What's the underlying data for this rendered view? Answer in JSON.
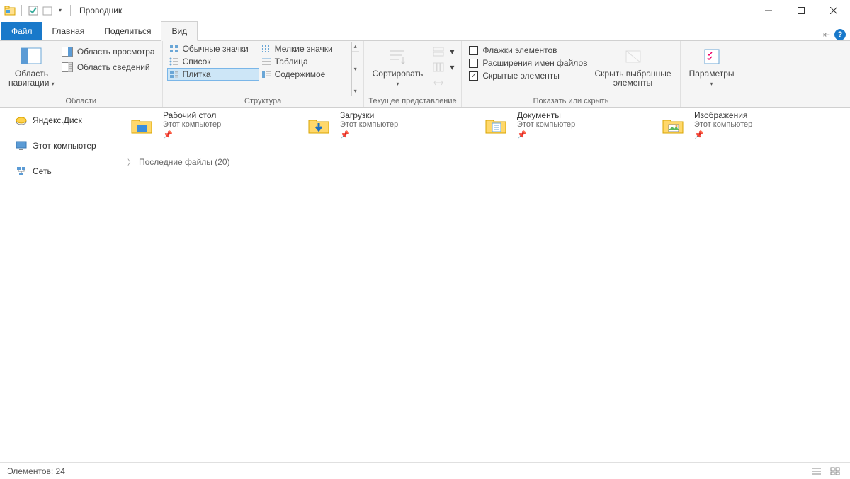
{
  "window": {
    "title": "Проводник"
  },
  "tabs": {
    "file": "Файл",
    "home": "Главная",
    "share": "Поделиться",
    "view": "Вид"
  },
  "ribbon": {
    "panes": {
      "navigation": "Область\nнавигации",
      "preview": "Область просмотра",
      "details_pane": "Область сведений",
      "group_label": "Области"
    },
    "layout": {
      "normal_icons": "Обычные значки",
      "small_icons": "Мелкие значки",
      "list": "Список",
      "table": "Таблица",
      "tiles": "Плитка",
      "content": "Содержимое",
      "group_label": "Структура"
    },
    "current_view": {
      "sort": "Сортировать",
      "group_label": "Текущее представление"
    },
    "show_hide": {
      "item_checkboxes": "Флажки элементов",
      "file_ext": "Расширения имен файлов",
      "hidden_items": "Скрытые элементы",
      "hide_selected": "Скрыть выбранные\nэлементы",
      "group_label": "Показать или скрыть"
    },
    "options": "Параметры"
  },
  "nav": {
    "yandex_disk": "Яндекс.Диск",
    "this_pc": "Этот компьютер",
    "network": "Сеть"
  },
  "tiles": {
    "desktop": {
      "name": "Рабочий стол",
      "sub": "Этот компьютер"
    },
    "downloads": {
      "name": "Загрузки",
      "sub": "Этот компьютер"
    },
    "documents": {
      "name": "Документы",
      "sub": "Этот компьютер"
    },
    "pictures": {
      "name": "Изображения",
      "sub": "Этот компьютер"
    }
  },
  "section": {
    "recent": "Последние файлы (20)"
  },
  "status": {
    "items": "Элементов: 24"
  }
}
